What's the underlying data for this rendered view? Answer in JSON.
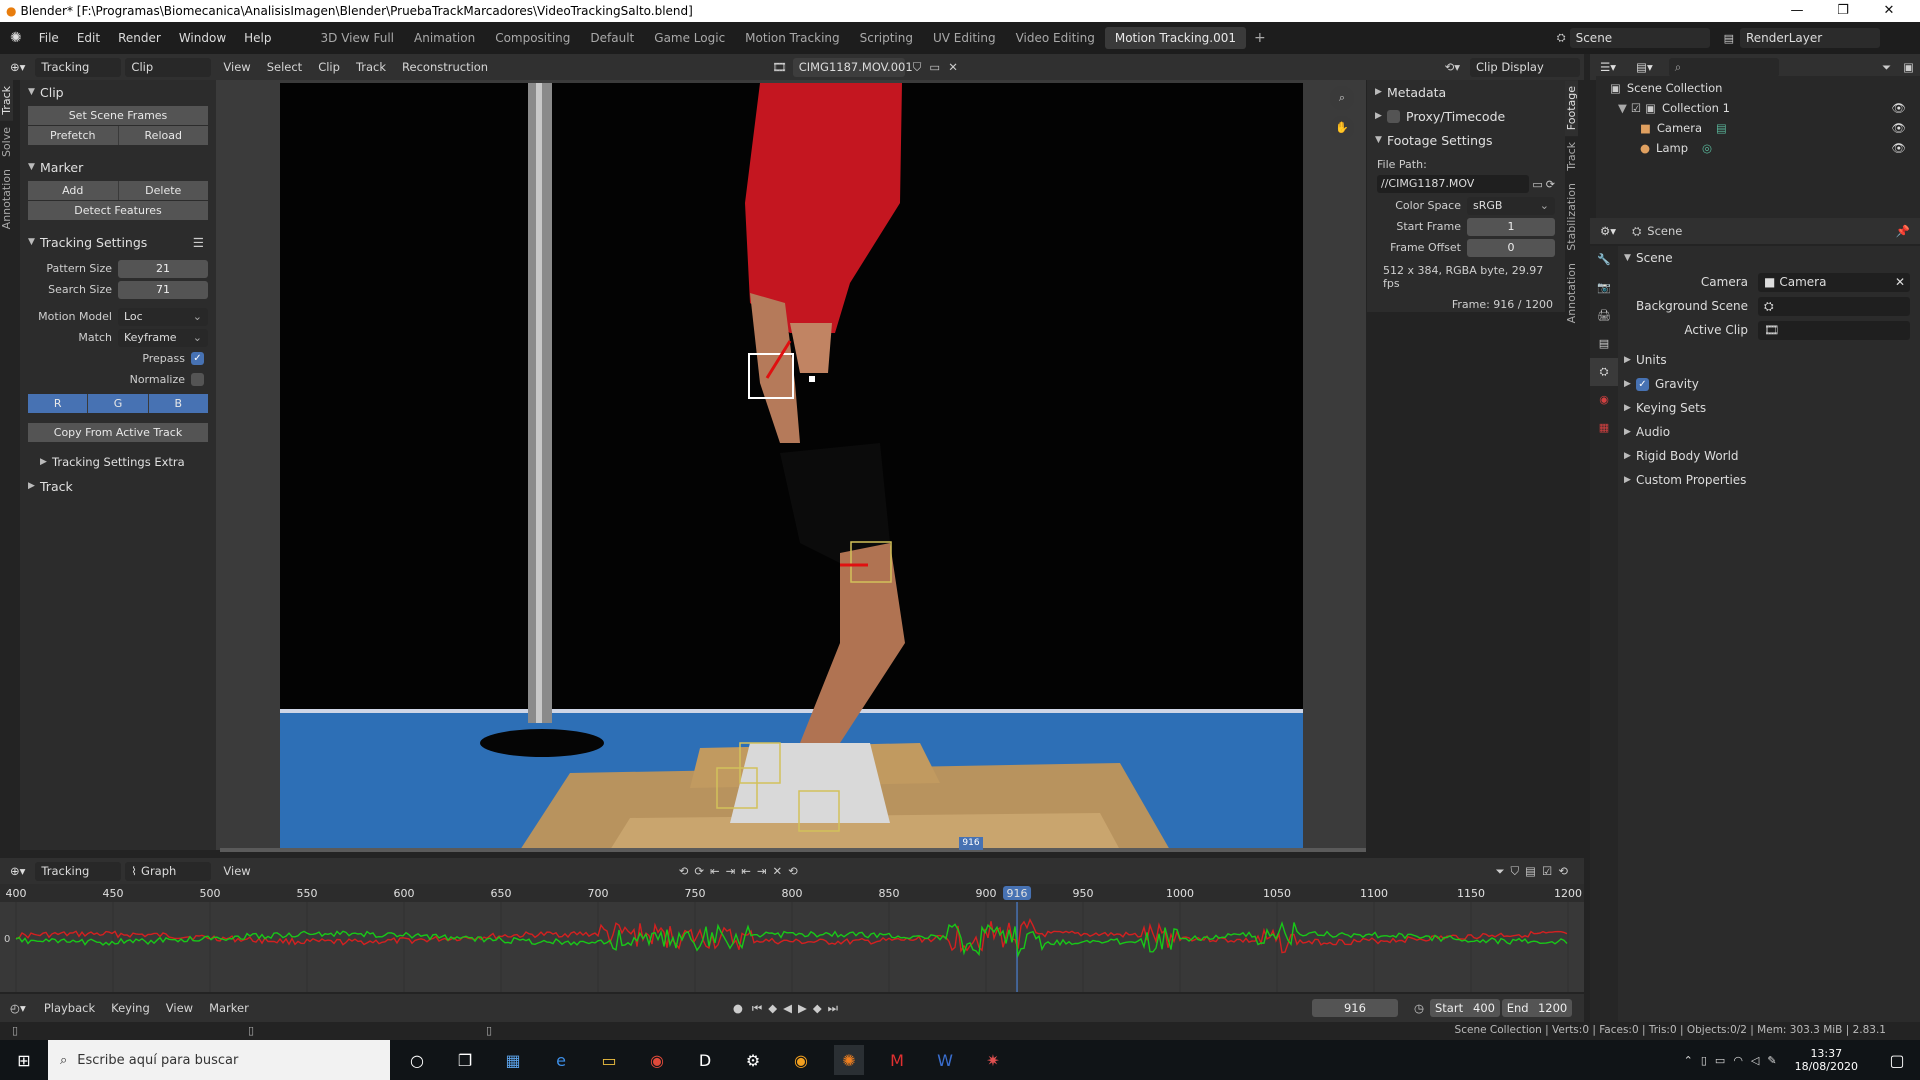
{
  "window": {
    "title": "Blender* [F:\\Programas\\Biomecanica\\AnalisisImagen\\Blender\\PruebaTrackMarcadores\\VideoTrackingSalto.blend]",
    "controls": [
      "—",
      "❐",
      "✕"
    ]
  },
  "topbar": {
    "menus": [
      "File",
      "Edit",
      "Render",
      "Window",
      "Help"
    ],
    "workspaces": [
      "3D View Full",
      "Animation",
      "Compositing",
      "Default",
      "Game Logic",
      "Motion Tracking",
      "Scripting",
      "UV Editing",
      "Video Editing",
      "Motion Tracking.001"
    ],
    "active_workspace": "Motion Tracking.001",
    "scene": "Scene",
    "view_layer": "RenderLayer"
  },
  "clip_header": {
    "mode": "Tracking",
    "view": "Clip",
    "menus": [
      "View",
      "Select",
      "Clip",
      "Track",
      "Reconstruction"
    ],
    "clip_name": "CIMG1187.MOV.001",
    "display": "Clip Display"
  },
  "left_tabs": [
    "Track",
    "Solve",
    "Annotation"
  ],
  "left_panel": {
    "clip": {
      "title": "Clip",
      "set_scene_frames": "Set Scene Frames",
      "prefetch": "Prefetch",
      "reload": "Reload"
    },
    "marker": {
      "title": "Marker",
      "add": "Add",
      "delete": "Delete",
      "detect": "Detect Features"
    },
    "tracking_settings": {
      "title": "Tracking Settings",
      "pattern_size_label": "Pattern Size",
      "pattern_size": "21",
      "search_size_label": "Search Size",
      "search_size": "71",
      "motion_model_label": "Motion Model",
      "motion_model": "Loc",
      "match_label": "Match",
      "match": "Keyframe",
      "prepass_label": "Prepass",
      "prepass": true,
      "normalize_label": "Normalize",
      "normalize": false,
      "channels": [
        "R",
        "G",
        "B"
      ],
      "copy": "Copy From Active Track",
      "extra": "Tracking Settings Extra"
    },
    "track": {
      "title": "Track"
    }
  },
  "n_sidebar": {
    "metadata": "Metadata",
    "proxy": "Proxy/Timecode",
    "footage_settings": "Footage Settings",
    "file_path_label": "File Path:",
    "file_path": "//CIMG1187.MOV",
    "color_space_label": "Color Space",
    "color_space": "sRGB",
    "start_frame_label": "Start Frame",
    "start_frame": "1",
    "frame_offset_label": "Frame Offset",
    "frame_offset": "0",
    "info": "512 x 384, RGBA byte, 29.97 fps",
    "frame": "Frame: 916 / 1200"
  },
  "right_tabs": [
    "Footage",
    "Track",
    "Stabilization",
    "Annotation"
  ],
  "outliner": {
    "root": "Scene Collection",
    "collection": "Collection 1",
    "items": [
      "Camera",
      "Lamp"
    ]
  },
  "properties": {
    "context": "Scene",
    "section": "Scene",
    "camera_label": "Camera",
    "camera": "Camera",
    "background_label": "Background Scene",
    "active_clip_label": "Active Clip",
    "panels": [
      "Units",
      "Gravity",
      "Keying Sets",
      "Audio",
      "Rigid Body World",
      "Custom Properties"
    ]
  },
  "graph": {
    "mode": "Tracking",
    "view": "Graph",
    "menu": "View",
    "ticks": [
      "400",
      "450",
      "500",
      "550",
      "600",
      "650",
      "700",
      "750",
      "800",
      "850",
      "900",
      "916",
      "950",
      "1000",
      "1050",
      "1100",
      "1150",
      "1200"
    ],
    "current": "916",
    "zero_label": "0"
  },
  "timeline": {
    "menus": [
      "Playback",
      "Keying",
      "View",
      "Marker"
    ],
    "frame": "916",
    "start_label": "Start",
    "start": "400",
    "end_label": "End",
    "end": "1200"
  },
  "scrub_label": "916",
  "status": "Scene Collection | Verts:0 | Faces:0 | Tris:0 | Objects:0/2 | Mem: 303.3 MiB | 2.83.1",
  "taskbar": {
    "search_placeholder": "Escribe aquí para buscar",
    "time": "13:37",
    "date": "18/08/2020"
  }
}
